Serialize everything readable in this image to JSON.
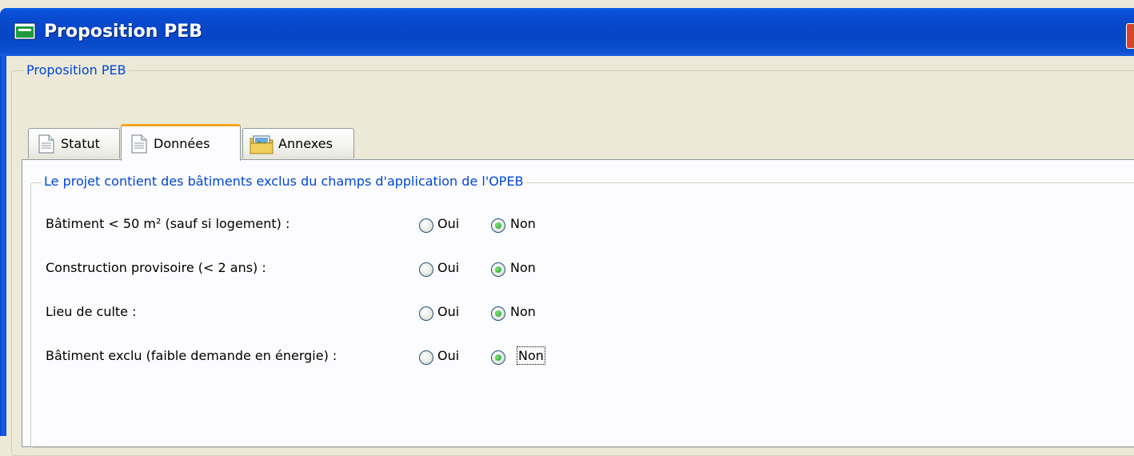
{
  "window": {
    "title": "Proposition PEB"
  },
  "outer_group": {
    "legend": "Proposition PEB"
  },
  "tabs": [
    {
      "label": "Statut",
      "icon": "document-icon",
      "selected": false
    },
    {
      "label": "Données",
      "icon": "document-icon",
      "selected": true
    },
    {
      "label": "Annexes",
      "icon": "folder-picture-icon",
      "selected": false
    }
  ],
  "section": {
    "legend": "Le projet contient des bâtiments exclus du champs d'application de l'OPEB",
    "questions": [
      {
        "label": "Bâtiment < 50 m² (sauf si logement) :",
        "yes": "Oui",
        "no": "Non",
        "selected": "Non"
      },
      {
        "label": "Construction provisoire (< 2 ans) :",
        "yes": "Oui",
        "no": "Non",
        "selected": "Non"
      },
      {
        "label": "Lieu de culte :",
        "yes": "Oui",
        "no": "Non",
        "selected": "Non"
      },
      {
        "label": "Bâtiment exclu (faible demande en énergie) :",
        "yes": "Oui",
        "no": "Non",
        "selected": "Non"
      }
    ]
  },
  "colors": {
    "accent": "#0046d5",
    "title_bar": "#0546c6",
    "tab_highlight": "#f5a623",
    "background": "#ece9d8"
  }
}
